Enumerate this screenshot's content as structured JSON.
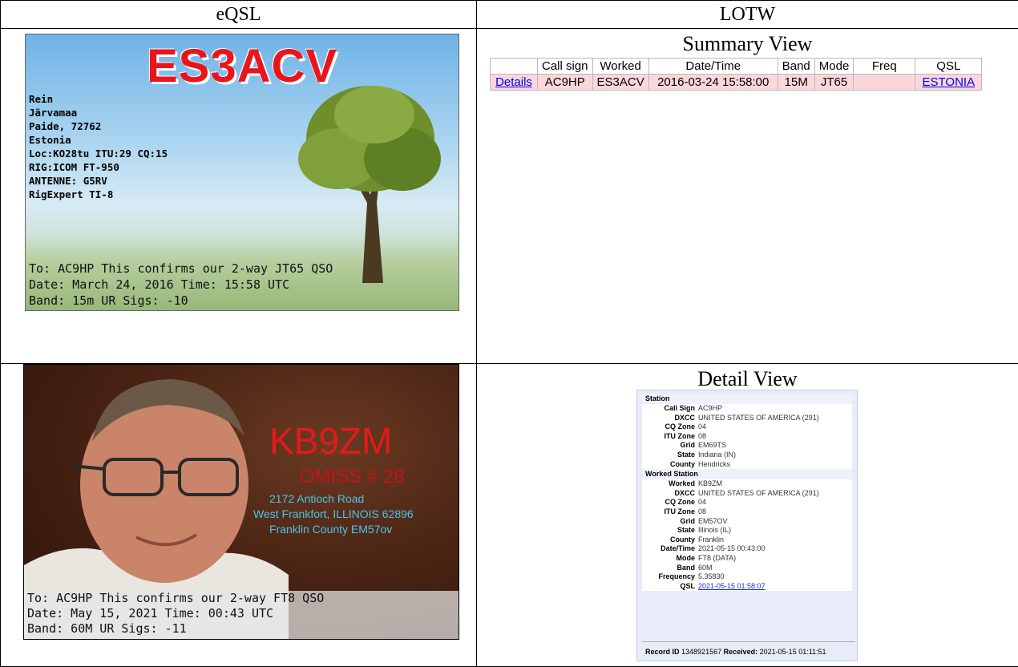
{
  "headers": {
    "eqsl": "eQSL",
    "lotw": "LOTW"
  },
  "card1": {
    "callsign": "ES3ACV",
    "info": [
      "Rein",
      "Järvamaa",
      "Paide, 72762",
      "Estonia",
      "Loc:KO28tu ITU:29 CQ:15",
      "RIG:ICOM FT-950",
      "ANTENNE: G5RV",
      "RigExpert TI-8"
    ],
    "confirm": [
      "To: AC9HP This confirms our 2-way JT65 QSO",
      "Date: March 24, 2016  Time: 15:58 UTC",
      "Band: 15m UR Sigs: -10"
    ]
  },
  "card2": {
    "callsign": "KB9ZM",
    "omiss": "OMISS # 28",
    "address": [
      "2172 Antioch Road",
      "West Frankfort, ILLINOIS 62896",
      "Franklin County  EM57ov"
    ],
    "confirm": [
      "To: AC9HP This confirms our 2-way FT8 QSO",
      "Date: May 15, 2021  Time: 00:43 UTC",
      "Band: 60M UR Sigs: -11"
    ]
  },
  "summary": {
    "title": "Summary View",
    "columns": [
      "",
      "Call sign",
      "Worked",
      "Date/Time",
      "Band",
      "Mode",
      "Freq",
      "QSL"
    ],
    "row": {
      "details": "Details",
      "callsign": "AC9HP",
      "worked": "ES3ACV",
      "datetime": "2016-03-24 15:58:00",
      "band": "15M",
      "mode": "JT65",
      "freq": "",
      "qsl": "ESTONIA"
    }
  },
  "detail": {
    "title": "Detail View",
    "station_header": "Station",
    "station": [
      {
        "k": "Call Sign",
        "v": "AC9HP"
      },
      {
        "k": "DXCC",
        "v": "UNITED STATES OF AMERICA (291)"
      },
      {
        "k": "CQ Zone",
        "v": "04"
      },
      {
        "k": "ITU Zone",
        "v": "08"
      },
      {
        "k": "Grid",
        "v": "EM69TS"
      },
      {
        "k": "State",
        "v": "Indiana (IN)"
      },
      {
        "k": "County",
        "v": "Hendricks"
      }
    ],
    "worked_header": "Worked Station",
    "worked": [
      {
        "k": "Worked",
        "v": "KB9ZM"
      },
      {
        "k": "DXCC",
        "v": "UNITED STATES OF AMERICA (291)"
      },
      {
        "k": "CQ Zone",
        "v": "04"
      },
      {
        "k": "ITU Zone",
        "v": "08"
      },
      {
        "k": "Grid",
        "v": "EM57OV"
      },
      {
        "k": "State",
        "v": "Illinois (IL)"
      },
      {
        "k": "County",
        "v": "Franklin"
      },
      {
        "k": "Date/Time",
        "v": "2021-05-15 00:43:00"
      },
      {
        "k": "Mode",
        "v": "FT8 (DATA)"
      },
      {
        "k": "Band",
        "v": "60M"
      },
      {
        "k": "Frequency",
        "v": "5.35830"
      }
    ],
    "qsl_label": "QSL",
    "qsl_link": "2021-05-15 01:58:07",
    "record_label": "Record ID",
    "record_id": "1348921567",
    "received_label": "Received:",
    "received": "2021-05-15 01:11:51"
  }
}
